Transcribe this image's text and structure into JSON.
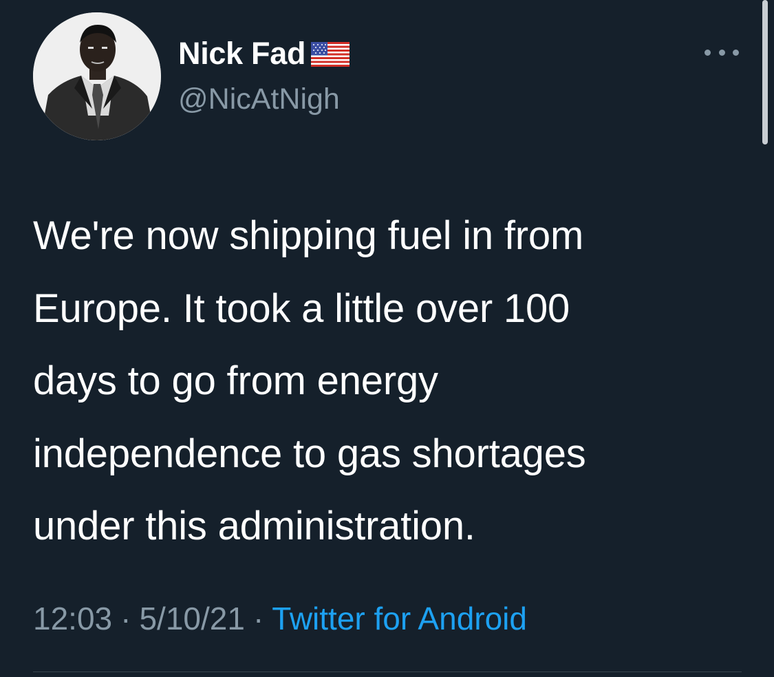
{
  "author": {
    "display_name": "Nick Fad",
    "handle": "@NicAtNigh",
    "flag_icon": "us-flag-emoji",
    "avatar_icon": "profile-photo"
  },
  "more_icon": "more-horizontal-icon",
  "tweet": {
    "lines": [
      "We're now shipping fuel in from",
      "Europe. It took a little over 100",
      "days to go from energy",
      "independence to gas shortages",
      "under this administration."
    ]
  },
  "meta": {
    "time": "12:03",
    "separator": "·",
    "date": "5/10/21",
    "source": "Twitter for Android"
  },
  "colors": {
    "background": "#15202b",
    "text": "#ffffff",
    "secondary": "#8899a6",
    "link": "#1da1f2",
    "divider": "#38444d"
  }
}
